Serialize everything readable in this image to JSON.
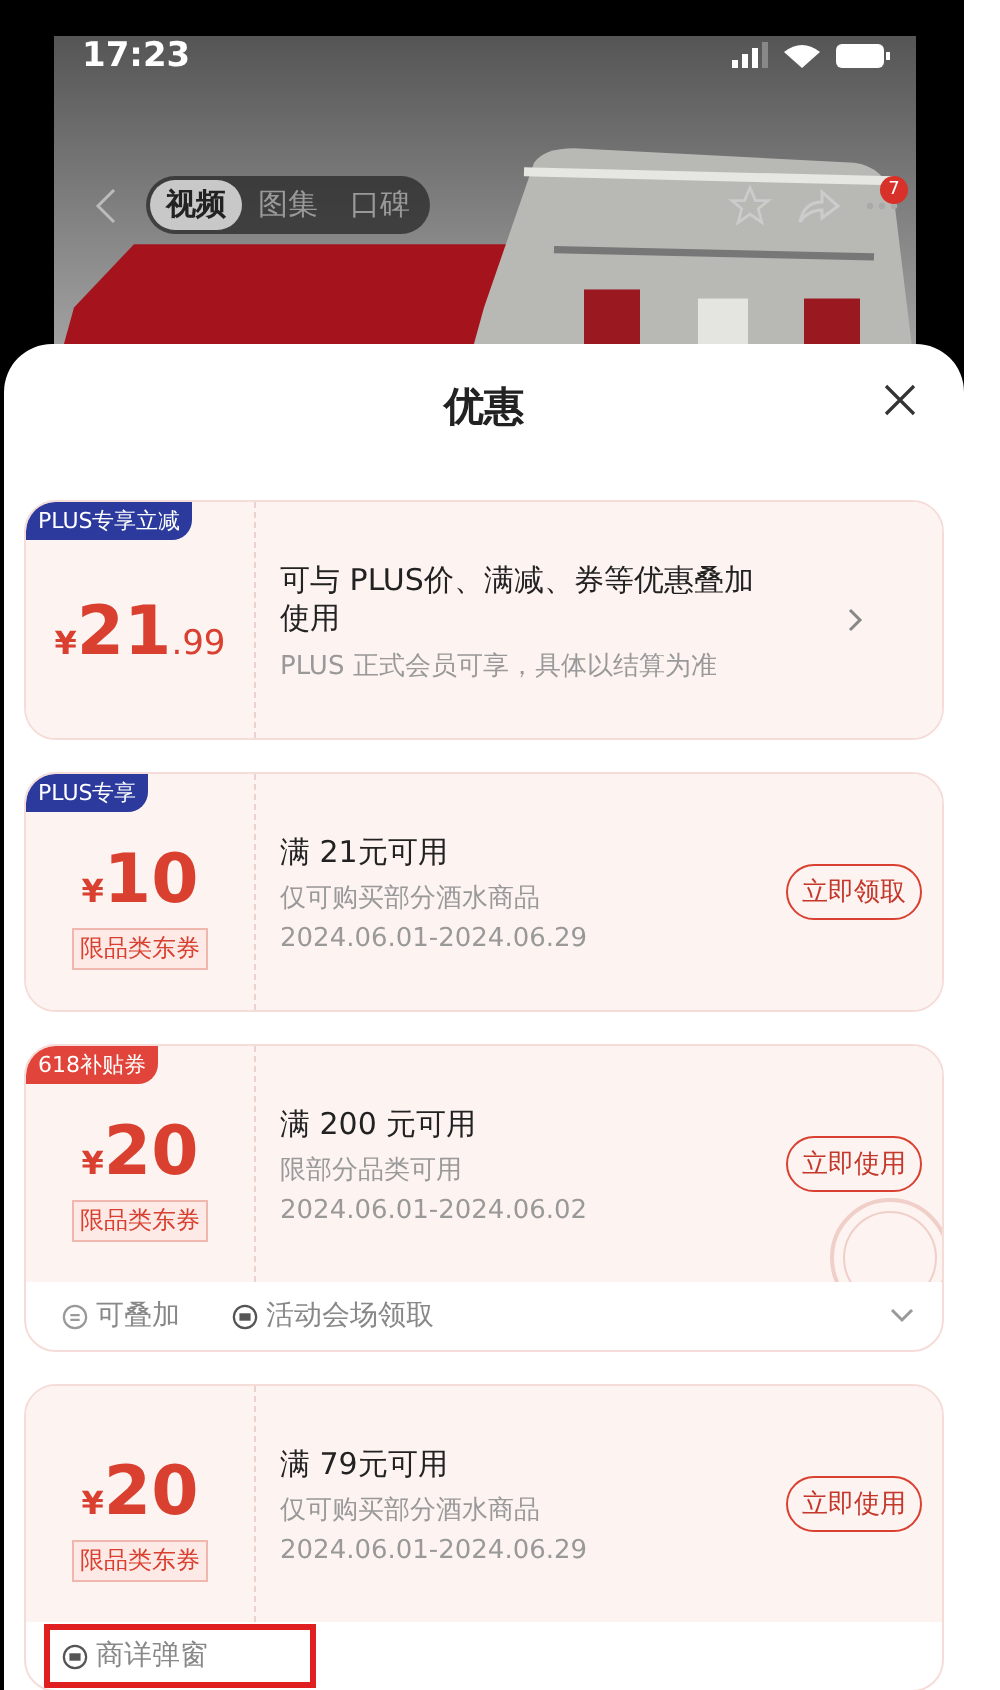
{
  "status_bar": {
    "time": "17:23"
  },
  "nav": {
    "tabs": [
      {
        "label": "视频",
        "selected": true
      },
      {
        "label": "图集",
        "selected": false
      },
      {
        "label": "口碑",
        "selected": false
      }
    ],
    "badge": "7"
  },
  "sheet": {
    "title": "优惠"
  },
  "coupons": [
    {
      "kind": "detail",
      "tag": {
        "text": "PLUS专享立减",
        "color": "#2b3a9c"
      },
      "currency": "¥",
      "amount": "21",
      "decimal": ".99",
      "title": "可与 PLUS价、满减、券等优惠叠加使用",
      "subtitle": "PLUS 正式会员可享，具体以结算为准"
    },
    {
      "kind": "action",
      "tag": {
        "text": "PLUS专享",
        "color": "#2b3a9c"
      },
      "currency": "¥",
      "amount": "10",
      "label": "限品类东券",
      "title": "满 21元可用",
      "subtitle": "仅可购买部分酒水商品",
      "dates": "2024.06.01-2024.06.29",
      "button": "立即领取"
    },
    {
      "kind": "action",
      "tag": {
        "text": "618补贴券",
        "color": "#e0443a"
      },
      "currency": "¥",
      "amount": "20",
      "label": "限品类东券",
      "title": "满 200 元可用",
      "subtitle": "限部分品类可用",
      "dates": "2024.06.01-2024.06.02",
      "button": "立即使用",
      "stamped": true,
      "footer": {
        "items": [
          {
            "kind": "stack",
            "text": "可叠加",
            "highlighted": false
          },
          {
            "kind": "ticket",
            "text": "活动会场领取",
            "highlighted": false
          }
        ],
        "expandable": true
      }
    },
    {
      "kind": "action",
      "currency": "¥",
      "amount": "20",
      "label": "限品类东券",
      "title": "满 79元可用",
      "subtitle": "仅可购买部分酒水商品",
      "dates": "2024.06.01-2024.06.29",
      "button": "立即使用",
      "footer": {
        "items": [
          {
            "kind": "ticket",
            "text": "商详弹窗",
            "highlighted": true
          }
        ]
      }
    }
  ]
}
